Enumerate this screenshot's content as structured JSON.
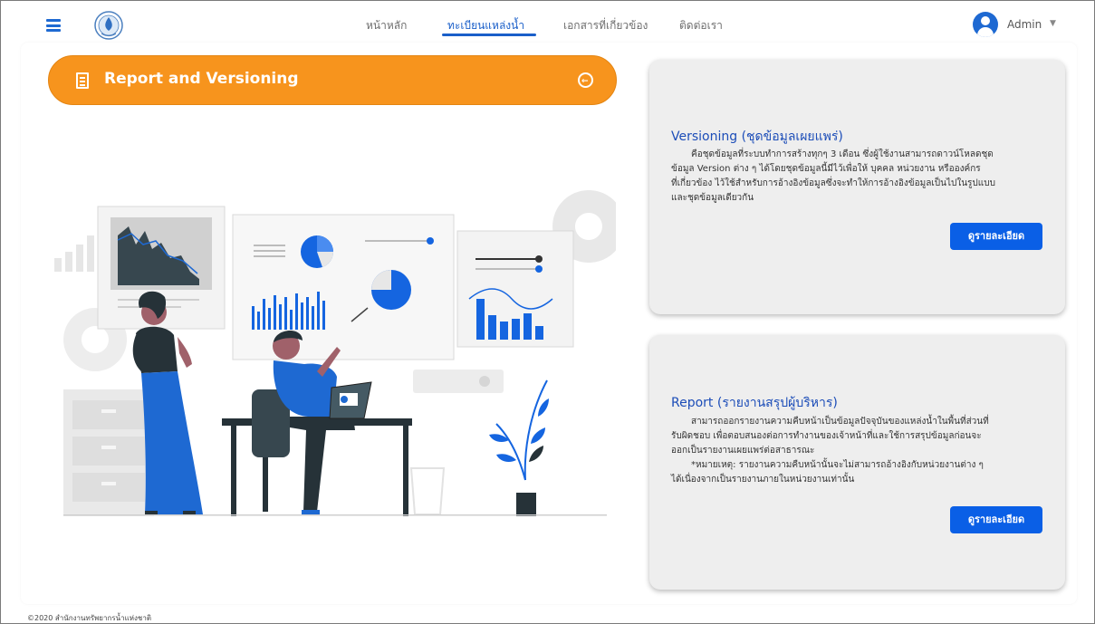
{
  "header": {
    "nav": [
      {
        "label": "หน้าหลัก"
      },
      {
        "label": "ทะเบียนแหล่งน้ำ"
      },
      {
        "label": "เอกสารที่เกี่ยวข้อง"
      },
      {
        "label": "ติดต่อเรา"
      }
    ],
    "active_nav": "ทะเบียนแหล่งน้ำ",
    "user_name": "Admin"
  },
  "banner": {
    "title": "Report and Versioning",
    "color": "#f7941d"
  },
  "cards": [
    {
      "title": "Versioning (ชุดข้อมูลเผยแพร่)",
      "lines": [
        "คือชุดข้อมูลที่ระบบทำการสร้างทุกๆ 3 เดือน ซึ่งผู้ใช้งานสามารถดาวน์โหลดชุด",
        "ข้อมูล Version ต่าง ๆ ได้โดยชุดข้อมูลนี้มีไว้เพื่อให้ บุคคล หน่วยงาน หรือองค์กร",
        "ที่เกี่ยวข้อง ไว้ใช้สำหรับการอ้างอิงข้อมูลซึ่งจะทำให้การอ้างอิงข้อมูลเป็นไปในรูปแบบ",
        "และชุดข้อมูลเดียวกัน"
      ],
      "button": "ดูรายละเอียด"
    },
    {
      "title": "Report (รายงานสรุปผู้บริหาร)",
      "lines": [
        "สามารถออกรายงานความคืบหน้าเป็นข้อมูลปัจจุบันของแหล่งน้ำในพื้นที่ส่วนที่",
        "รับผิดชอบ เพื่อตอบสนองต่อการทำงานของเจ้าหน้าที่และใช้การสรุปข้อมูลก่อนจะ",
        "ออกเป็นรายงานเผยแพร่ต่อสาธารณะ",
        "*หมายเหตุ: รายงานความคืบหน้านั้นจะไม่สามารถอ้างอิงกับหน่วยงานต่าง ๆ",
        "ได้เนื่องจากเป็นรายงานภายในหน่วยงานเท่านั้น"
      ],
      "button": "ดูรายละเอียด"
    }
  ],
  "footer": "©2020 สำนักงานทรัพยากรน้ำแห่งชาติ",
  "colors": {
    "accent_blue": "#0a5fe6",
    "title_blue": "#1c4db8",
    "card_bg": "#eeeeee"
  },
  "icons": [
    "hamburger-icon",
    "logo-emblem",
    "user-avatar-icon",
    "caret-down-icon",
    "document-icon",
    "back-circle-icon"
  ]
}
